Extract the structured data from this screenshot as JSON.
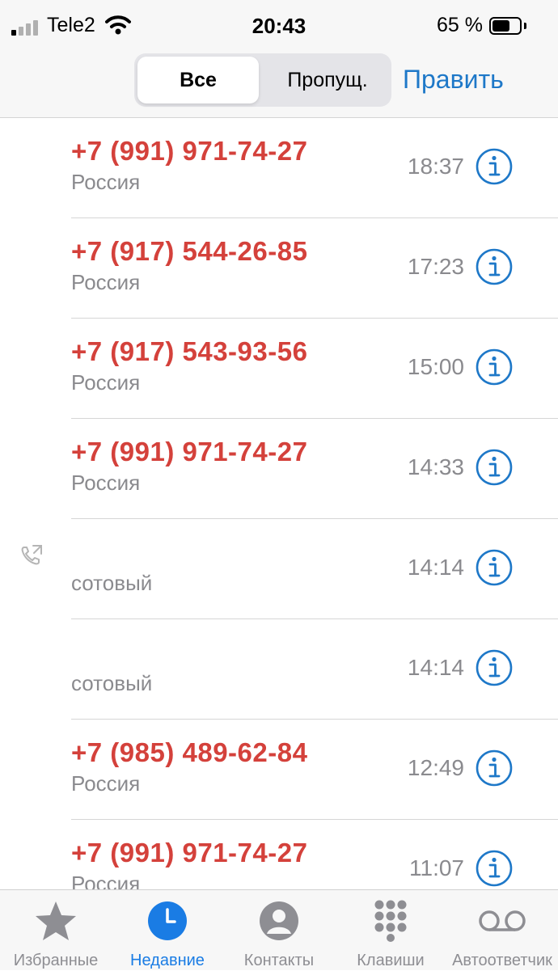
{
  "status_bar": {
    "carrier": "Tele2",
    "time": "20:43",
    "battery_percent": "65 %",
    "battery_level": 0.65,
    "signal_bars_filled": 1,
    "signal_bars_total": 4
  },
  "header": {
    "segments": [
      "Все",
      "Пропущ."
    ],
    "selected_segment": "Все",
    "edit_label": "Править"
  },
  "calls": [
    {
      "number": "+7 (991) 971-74-27",
      "subtitle": "Россия",
      "time": "18:37",
      "missed": true,
      "outgoing": false
    },
    {
      "number": "+7 (917) 544-26-85",
      "subtitle": "Россия",
      "time": "17:23",
      "missed": true,
      "outgoing": false
    },
    {
      "number": "+7 (917) 543-93-56",
      "subtitle": "Россия",
      "time": "15:00",
      "missed": true,
      "outgoing": false
    },
    {
      "number": "+7 (991) 971-74-27",
      "subtitle": "Россия",
      "time": "14:33",
      "missed": true,
      "outgoing": false
    },
    {
      "number": "",
      "subtitle": "сотовый",
      "time": "14:14",
      "missed": false,
      "outgoing": true
    },
    {
      "number": "",
      "subtitle": "сотовый",
      "time": "14:14",
      "missed": false,
      "outgoing": false
    },
    {
      "number": "+7 (985) 489-62-84",
      "subtitle": "Россия",
      "time": "12:49",
      "missed": true,
      "outgoing": false
    },
    {
      "number": "+7 (991) 971-74-27",
      "subtitle": "Россия",
      "time": "11:07",
      "missed": true,
      "outgoing": false
    }
  ],
  "tabbar": {
    "tabs": [
      {
        "label": "Избранные",
        "icon": "star-icon"
      },
      {
        "label": "Недавние",
        "icon": "clock-icon"
      },
      {
        "label": "Контакты",
        "icon": "contact-icon"
      },
      {
        "label": "Клавиши",
        "icon": "keypad-icon"
      },
      {
        "label": "Автоответчик",
        "icon": "voicemail-icon"
      }
    ],
    "active_tab": "Недавние"
  },
  "colors": {
    "missed_call": "#d4413b",
    "accent": "#1e78c8",
    "active_tab": "#1a7ce4",
    "inactive_tab": "#8e8e93",
    "secondary_text": "#8a8a8e"
  }
}
